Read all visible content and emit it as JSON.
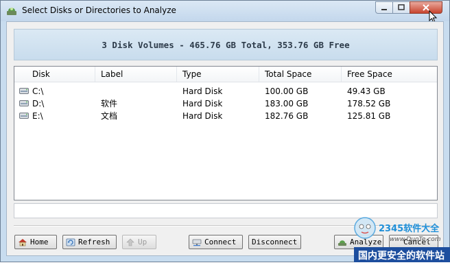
{
  "window": {
    "title": "Select Disks or Directories to Analyze"
  },
  "summary": {
    "text": "3 Disk Volumes - 465.76 GB Total, 353.76 GB Free"
  },
  "columns": [
    "Disk",
    "Label",
    "Type",
    "Total Space",
    "Free Space"
  ],
  "rows": [
    {
      "disk": "C:\\",
      "label": "",
      "type": "Hard Disk",
      "total": "100.00 GB",
      "free": "49.43 GB"
    },
    {
      "disk": "D:\\",
      "label": "软件",
      "type": "Hard Disk",
      "total": "183.00 GB",
      "free": "178.52 GB"
    },
    {
      "disk": "E:\\",
      "label": "文档",
      "type": "Hard Disk",
      "total": "182.76 GB",
      "free": "125.81 GB"
    }
  ],
  "buttons": {
    "home": "Home",
    "refresh": "Refresh",
    "up": "Up",
    "connect": "Connect",
    "disconnect": "Disconnect",
    "analyze": "Analyze",
    "cancel": "Cancel"
  },
  "watermark": {
    "brand": "2345软件大全",
    "site": "www.DuoTe.com",
    "slogan": "国内更安全的软件站"
  },
  "colors": {
    "title_bar": "#c3d7ec",
    "summary_bg": "#d2e3f1",
    "close_button": "#c8442e"
  }
}
